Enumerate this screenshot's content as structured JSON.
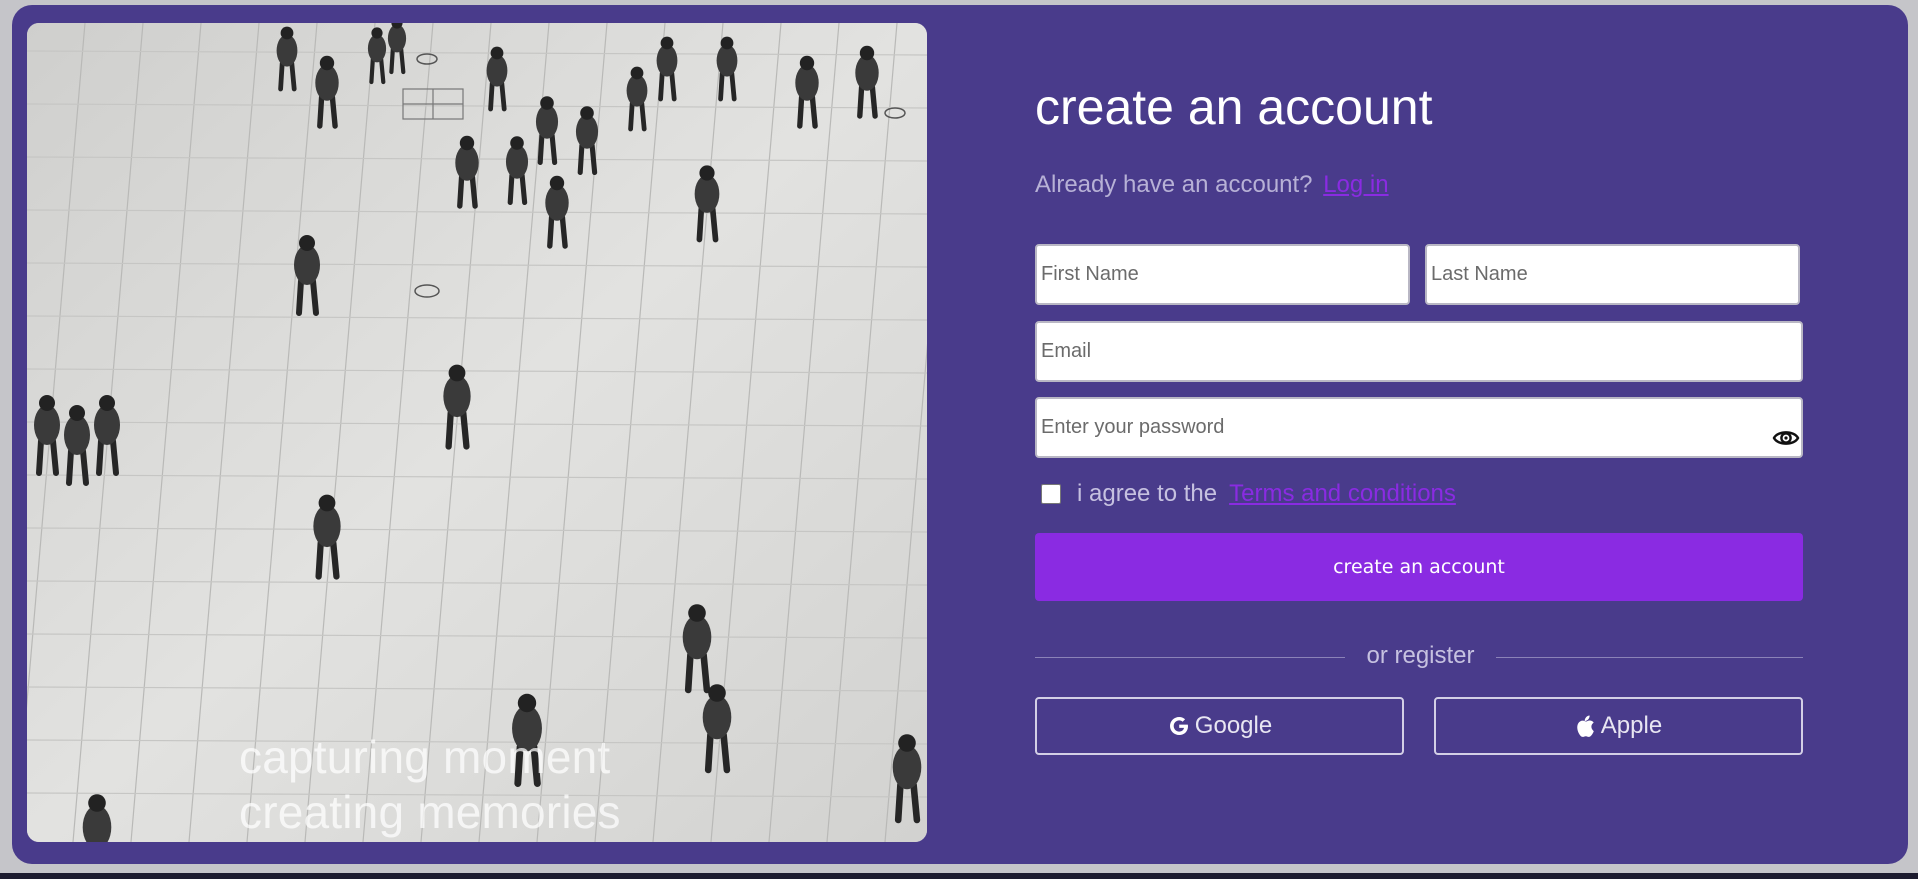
{
  "photo": {
    "caption_line1": "capturing moment",
    "caption_line2": "creating memories"
  },
  "form": {
    "title": "create an account",
    "login_prompt": "Already have an account?",
    "login_link": "Log in",
    "first_name_placeholder": "First Name",
    "last_name_placeholder": "Last Name",
    "email_placeholder": "Email",
    "password_placeholder": "Enter your password",
    "password_toggle_icon": "eye-icon",
    "agree_text": "i agree to the",
    "terms_link": "Terms and conditions",
    "agree_checked": false,
    "submit_label": "create an account",
    "divider_label": "or register",
    "google_label": "Google",
    "apple_label": "Apple"
  },
  "colors": {
    "card_background": "#493b8b",
    "accent": "#8a2be2",
    "page_background": "#c5c5c9"
  }
}
